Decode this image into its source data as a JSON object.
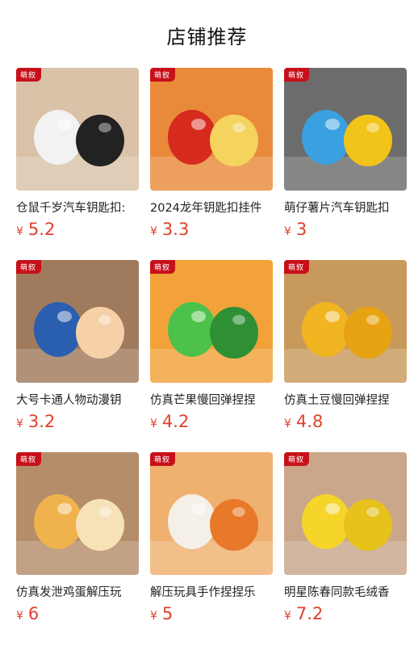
{
  "header": {
    "title": "店铺推荐"
  },
  "currency": "¥",
  "brand_tag": "萌叙",
  "products": [
    {
      "name": "仓鼠千岁汽车钥匙扣:",
      "price": "5.2",
      "thumb_icon": "hamster-keychain-image",
      "palette": [
        "#d9c2a8",
        "#f2f2f2",
        "#222222"
      ]
    },
    {
      "name": "2024龙年钥匙扣挂件",
      "price": "3.3",
      "thumb_icon": "dragon-keychain-image",
      "palette": [
        "#e98a3a",
        "#d62a1f",
        "#f4d35e"
      ]
    },
    {
      "name": "萌仔薯片汽车钥匙扣",
      "price": "3",
      "thumb_icon": "chips-keychain-image",
      "palette": [
        "#6c6c6c",
        "#3aa0e0",
        "#f2c318"
      ]
    },
    {
      "name": "大号卡通人物动漫钥",
      "price": "3.2",
      "thumb_icon": "cartoon-figure-keychain-image",
      "palette": [
        "#a07a5c",
        "#2a5fb0",
        "#f6d0a6"
      ]
    },
    {
      "name": "仿真芒果慢回弹捏捏",
      "price": "4.2",
      "thumb_icon": "mango-squishy-image",
      "palette": [
        "#f3a23a",
        "#4cc24a",
        "#2f8f34"
      ]
    },
    {
      "name": "仿真土豆慢回弹捏捏",
      "price": "4.8",
      "thumb_icon": "potato-squishy-image",
      "palette": [
        "#c79a5c",
        "#f1b521",
        "#e7a312"
      ]
    },
    {
      "name": "仿真发泄鸡蛋解压玩",
      "price": "6",
      "thumb_icon": "egg-squishy-image",
      "palette": [
        "#b58d6a",
        "#f0b24c",
        "#f6e2b6"
      ]
    },
    {
      "name": "解压玩具手作捏捏乐",
      "price": "5",
      "thumb_icon": "egg-yolk-pastry-image",
      "palette": [
        "#efb070",
        "#f4f0e8",
        "#e8782a"
      ]
    },
    {
      "name": "明星陈春同款毛绒香",
      "price": "7.2",
      "thumb_icon": "banana-plush-image",
      "palette": [
        "#caa68a",
        "#f5d52a",
        "#e6c21a"
      ]
    }
  ]
}
